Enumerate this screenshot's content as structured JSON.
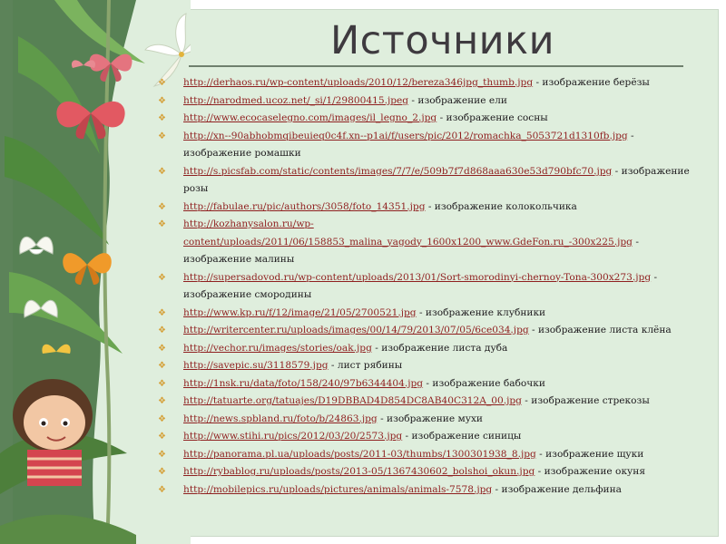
{
  "title": "Источники",
  "colors": {
    "panel": "#dfeedd",
    "link": "#8f1f1f",
    "bullet": "#d5a13a",
    "title": "#3e3a3f"
  },
  "bullet_icon": "star-bullet-icon",
  "sources": [
    {
      "url": "http://derhaos.ru/wp-content/uploads/2010/12/bereza346jpg_thumb.jpg",
      "desc": " - изображение берёзы"
    },
    {
      "url": "http://narodmed.ucoz.net/_si/1/29800415.jpeg",
      "desc": " - изображение ели"
    },
    {
      "url": "http://www.ecocaselegno.com/images/il_legno_2.jpg",
      "desc": " - изображение сосны"
    },
    {
      "url": "http://xn--90abhobmqibeuieq0c4f.xn--p1ai/f/users/pic/2012/romachka_5053721d1310fb.jpg",
      "desc": " - изображение ромашки"
    },
    {
      "url": "http://s.picsfab.com/static/contents/images/7/7/e/509b7f7d868aaa630e53d790bfc70.jpg",
      "desc": " - изображение розы"
    },
    {
      "url": "http://fabulae.ru/pic/authors/3058/foto_14351.jpg",
      "desc": " - изображение колокольчика"
    },
    {
      "url": "http://kozhanysalon.ru/wp-content/uploads/2011/06/158853_malina_yagody_1600x1200_www.GdeFon.ru_-300x225.jpg",
      "desc": " - изображение малины"
    },
    {
      "url": "http://supersadovod.ru/wp-content/uploads/2013/01/Sort-smorodinyi-chernoy-Tona-300x273.jpg",
      "desc": " - изображение смородины"
    },
    {
      "url": "http://www.kp.ru/f/12/image/21/05/2700521.jpg",
      "desc": " - изображение клубники"
    },
    {
      "url": "http://writercenter.ru/uploads/images/00/14/79/2013/07/05/6ce034.jpg",
      "desc": " - изображение листа клёна"
    },
    {
      "url": "http://vechor.ru/images/stories/oak.jpg",
      "desc": " - изображение листа дуба"
    },
    {
      "url": "http://savepic.su/3118579.jpg",
      "desc": " - лист рябины"
    },
    {
      "url": "http://1nsk.ru/data/foto/158/240/97b6344404.jpg",
      "desc": " - изображение бабочки"
    },
    {
      "url": "http://tatuarte.org/tatuajes/D19DBBAD4D854DC8AB40C312A_00.jpg",
      "desc": " - изображение стрекозы"
    },
    {
      "url": "http://news.spbland.ru/foto/b/24863.jpg",
      "desc": " - изображение мухи"
    },
    {
      "url": "http://www.stihi.ru/pics/2012/03/20/2573.jpg",
      "desc": " - изображение синицы"
    },
    {
      "url": "http://panorama.pl.ua/uploads/posts/2011-03/thumbs/1300301938_8.jpg",
      "desc": " - изображение щуки"
    },
    {
      "url": "http://rybablog.ru/uploads/posts/2013-05/1367430602_bolshoi_okun.jpg",
      "desc": " - изображение окуня"
    },
    {
      "url": "http://mobilepics.ru/uploads/pictures/animals/animals-7578.jpg",
      "desc": " - изображение дельфина"
    }
  ]
}
